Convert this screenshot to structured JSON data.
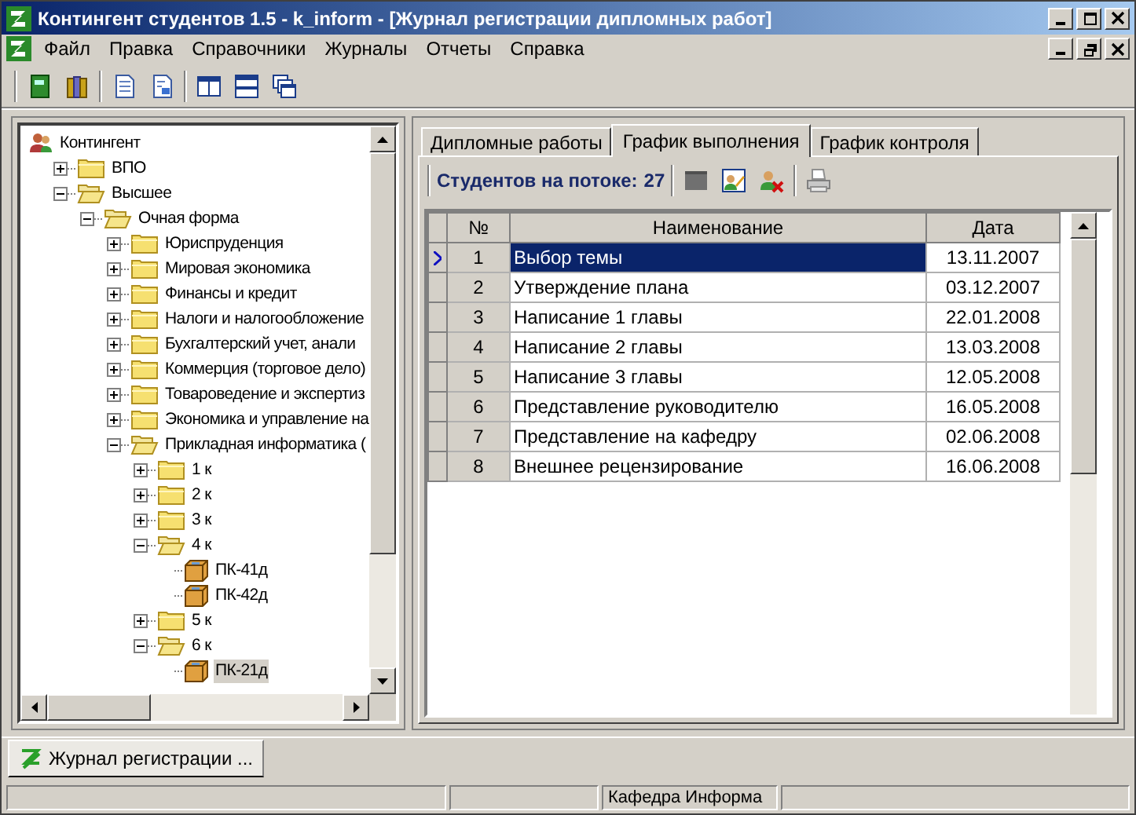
{
  "window": {
    "title": "Контингент студентов 1.5 - k_inform - [Журнал регистрации дипломных работ]"
  },
  "menu": [
    "Файл",
    "Правка",
    "Справочники",
    "Журналы",
    "Отчеты",
    "Справка"
  ],
  "tree": [
    {
      "label": "Контингент",
      "kind": "root",
      "selected": false,
      "children": [
        {
          "label": "ВПО",
          "kind": "folder",
          "expanded": false,
          "selected": false
        },
        {
          "label": "Высшее",
          "kind": "folder",
          "expanded": true,
          "selected": false,
          "children": [
            {
              "label": "Очная форма",
              "kind": "folder",
              "expanded": true,
              "selected": false,
              "children": [
                {
                  "label": "Юриспруденция",
                  "kind": "folder",
                  "expanded": false,
                  "selected": false
                },
                {
                  "label": "Мировая экономика",
                  "kind": "folder",
                  "expanded": false,
                  "selected": false
                },
                {
                  "label": "Финансы и кредит",
                  "kind": "folder",
                  "expanded": false,
                  "selected": false
                },
                {
                  "label": "Налоги и налогообложение",
                  "kind": "folder",
                  "expanded": false,
                  "selected": false
                },
                {
                  "label": "Бухгалтерский учет, анали",
                  "kind": "folder",
                  "expanded": false,
                  "selected": false
                },
                {
                  "label": "Коммерция (торговое дело)",
                  "kind": "folder",
                  "expanded": false,
                  "selected": false
                },
                {
                  "label": "Товароведение и экспертиз",
                  "kind": "folder",
                  "expanded": false,
                  "selected": false
                },
                {
                  "label": "Экономика и управление на",
                  "kind": "folder",
                  "expanded": false,
                  "selected": false
                },
                {
                  "label": "Прикладная информатика (",
                  "kind": "folder",
                  "expanded": true,
                  "selected": false,
                  "children": [
                    {
                      "label": "1 к",
                      "kind": "folder",
                      "expanded": false,
                      "selected": false
                    },
                    {
                      "label": "2 к",
                      "kind": "folder",
                      "expanded": false,
                      "selected": false
                    },
                    {
                      "label": "3 к",
                      "kind": "folder",
                      "expanded": false,
                      "selected": false
                    },
                    {
                      "label": "4 к",
                      "kind": "folder",
                      "expanded": true,
                      "selected": false,
                      "children": [
                        {
                          "label": "ПК-41д",
                          "kind": "group",
                          "selected": false
                        },
                        {
                          "label": "ПК-42д",
                          "kind": "group",
                          "selected": false
                        }
                      ]
                    },
                    {
                      "label": "5 к",
                      "kind": "folder",
                      "expanded": false,
                      "selected": false
                    },
                    {
                      "label": "6 к",
                      "kind": "folder",
                      "expanded": true,
                      "selected": false,
                      "children": [
                        {
                          "label": "ПК-21д",
                          "kind": "group",
                          "selected": true
                        }
                      ]
                    }
                  ]
                }
              ]
            }
          ]
        }
      ]
    }
  ],
  "tabs": [
    {
      "label": "Дипломные работы",
      "selected": false
    },
    {
      "label": "График выполнения",
      "selected": true
    },
    {
      "label": "График контроля",
      "selected": false
    }
  ],
  "toolbar": {
    "label": "Студентов на потоке:",
    "count": "27"
  },
  "table": {
    "columns": [
      "№",
      "Наименование",
      "Дата"
    ],
    "rows": [
      {
        "cells": [
          "1",
          "Выбор темы",
          "13.11.2007"
        ],
        "selected": true
      },
      {
        "cells": [
          "2",
          "Утверждение плана",
          "03.12.2007"
        ],
        "selected": false
      },
      {
        "cells": [
          "3",
          "Написание 1 главы",
          "22.01.2008"
        ],
        "selected": false
      },
      {
        "cells": [
          "4",
          "Написание 2 главы",
          "13.03.2008"
        ],
        "selected": false
      },
      {
        "cells": [
          "5",
          "Написание 3 главы",
          "12.05.2008"
        ],
        "selected": false
      },
      {
        "cells": [
          "6",
          "Представление руководителю",
          "16.05.2008"
        ],
        "selected": false
      },
      {
        "cells": [
          "7",
          "Представление на кафедру",
          "02.06.2008"
        ],
        "selected": false
      },
      {
        "cells": [
          "8",
          "Внешнее рецензирование",
          "16.06.2008"
        ],
        "selected": false
      }
    ]
  },
  "taskbar": [
    {
      "label": "Журнал регистрации ...",
      "selected": true
    }
  ],
  "status_bar": {
    "department": "Кафедра Информа"
  }
}
